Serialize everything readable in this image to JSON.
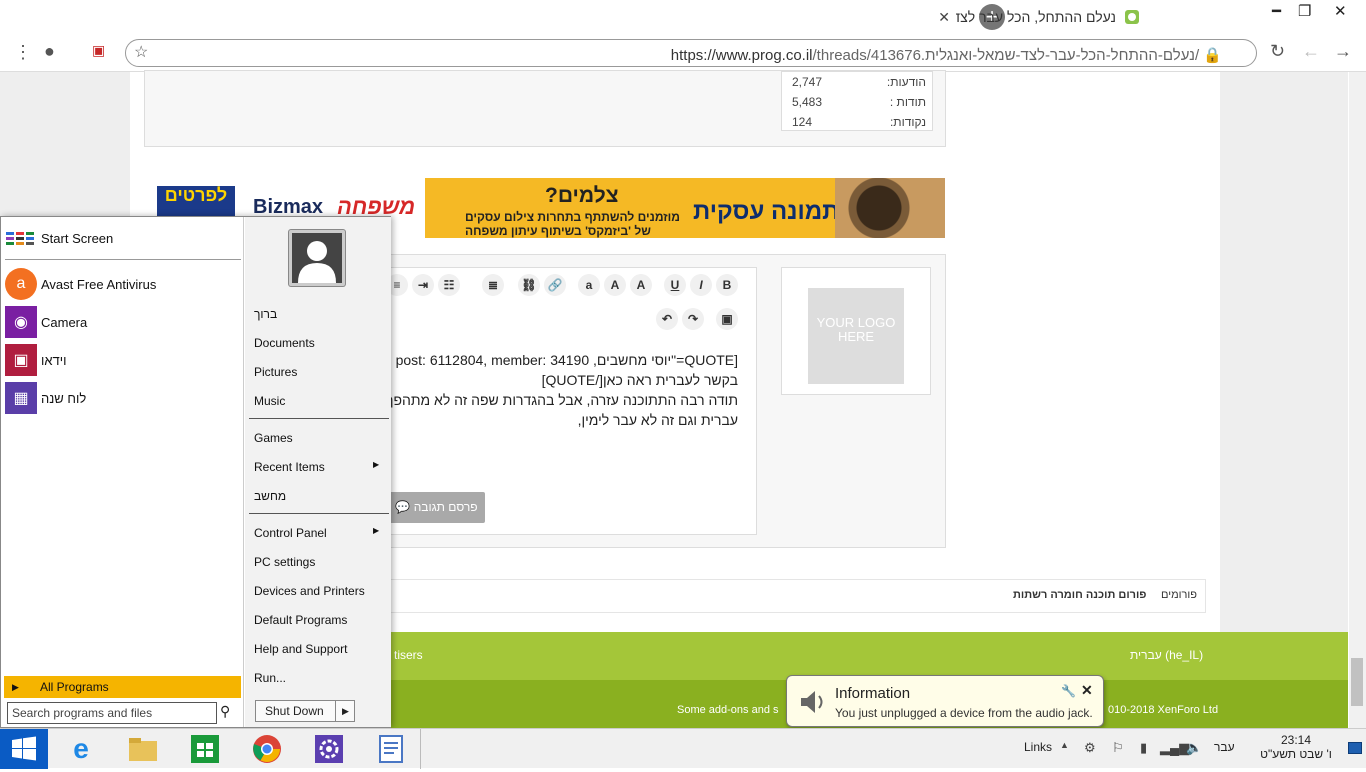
{
  "browser": {
    "tab_title": "נעלם ההתחל, הכל עבר לצד שמאל",
    "url_host": "https://www.prog.co.il",
    "url_path": "/threads/413676.נעלם-ההתחל-הכל-עבר-לצד-שמאל-ואנגלית/"
  },
  "stats": [
    {
      "label": "הודעות:",
      "value": "2,747"
    },
    {
      "label": "תודות :",
      "value": "5,483"
    },
    {
      "label": "נקודות:",
      "value": "124"
    }
  ],
  "banner": {
    "headline": "צלמים?",
    "sub1": "מוזמנים להשתתף בתחרות צילום עסקים",
    "sub2": "של 'ביזמקס' בשיתוף עיתון משפחה",
    "brand": "תמונה עסקית",
    "logo_mishpacha": "משפחה",
    "logo_bizmax": "Bizmax",
    "logo_lifratim": "לפרטים"
  },
  "editor": {
    "line1": "[QUOTE=\"יוסי מחשבים, post: 6112804, member: 34190",
    "line2": "בקשר לעברית ראה כאן[/QUOTE]",
    "line3": "תודה רבה התתוכנה עזרה, אבל בהגדרות שפה זה לא מתהפך",
    "line4": "עברית וגם זה לא עבר לימין,",
    "post_button": "פרסם תגובה"
  },
  "avatar_placeholder": "YOUR LOGO HERE",
  "breadcrumb": [
    "פורומים",
    "פורום תוכנה חומרה רשתות"
  ],
  "footer": {
    "language": "עברית (he_IL)",
    "advertisers": "tisers",
    "addons": "Some add-ons and s",
    "copyright": "010-2018 XenForo Ltd"
  },
  "startmenu": {
    "programs": [
      {
        "label": "Start Screen",
        "color": "#ffffff"
      },
      {
        "label": "Avast Free Antivirus",
        "color": "#f37021"
      },
      {
        "label": "Camera",
        "color": "#7a1fa2"
      },
      {
        "label": "וידאו",
        "color": "#b01e3f"
      },
      {
        "label": "לוח שנה",
        "color": "#5a3ea8"
      }
    ],
    "all_programs": "All Programs",
    "search_placeholder": "Search programs and files",
    "links": [
      "ברוך",
      "Documents",
      "Pictures",
      "Music",
      "Games",
      "Recent Items",
      "מחשב",
      "Control Panel",
      "PC settings",
      "Devices and Printers",
      "Default Programs",
      "Help and Support",
      "Run..."
    ],
    "shutdown": "Shut Down"
  },
  "notification": {
    "title": "Information",
    "message": "You just unplugged a device from the audio jack."
  },
  "taskbar": {
    "links_label": "Links",
    "language": "עבר",
    "time": "23:14",
    "date": "ו' שבט תשע\"ט"
  }
}
